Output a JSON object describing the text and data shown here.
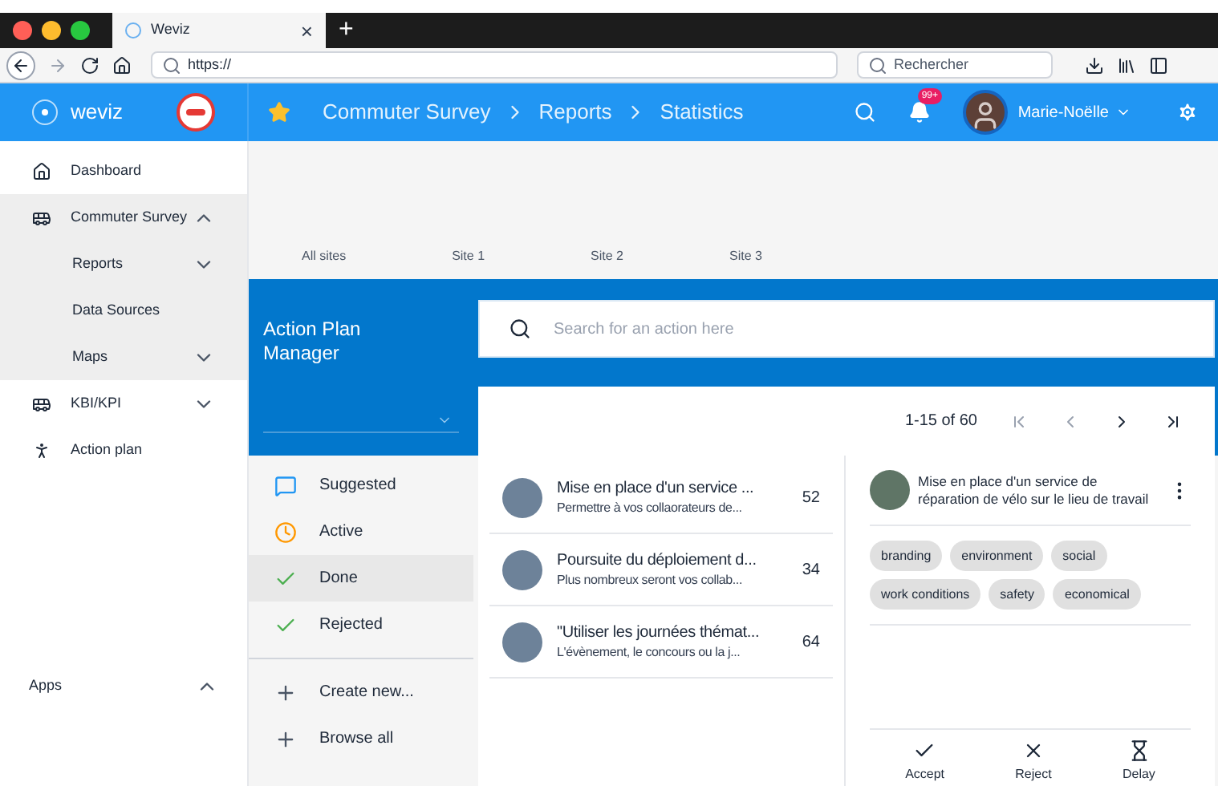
{
  "browser": {
    "tab_title": "Weviz",
    "tab_close": "×",
    "new_tab": "+",
    "url": "https://",
    "search_placeholder": "Rechercher"
  },
  "app_bar": {
    "brand": "weviz",
    "breadcrumbs": [
      "Commuter Survey",
      "Reports",
      "Statistics"
    ],
    "notification_count": "99+",
    "user": "Marie-Noëlle"
  },
  "sidebar": {
    "items": [
      {
        "label": "Dashboard",
        "kind": "home"
      },
      {
        "label": "Commuter Survey",
        "kind": "vehicle",
        "expanded": true,
        "children": [
          {
            "label": "Reports",
            "expanded": false
          },
          {
            "label": "Data Sources"
          },
          {
            "label": "Maps",
            "expanded": false
          }
        ]
      },
      {
        "label": "KBI/KPI",
        "kind": "vehicle",
        "expanded": false
      },
      {
        "label": "Action plan",
        "kind": "person"
      }
    ],
    "apps": {
      "label": "Apps",
      "expanded": true
    }
  },
  "site_tabs": [
    "All sites",
    "Site 1",
    "Site 2",
    "Site 3"
  ],
  "manager": {
    "title": "Action Plan Manager",
    "statuses": [
      {
        "label": "Suggested",
        "kind": "suggested",
        "selected": false
      },
      {
        "label": "Active",
        "kind": "active",
        "selected": false
      },
      {
        "label": "Done",
        "kind": "done",
        "selected": true
      },
      {
        "label": "Rejected",
        "kind": "rejected",
        "selected": false
      }
    ],
    "commands": [
      {
        "label": "Create new...",
        "kind": "plus"
      },
      {
        "label": "Browse all",
        "kind": "plus"
      }
    ]
  },
  "search": {
    "placeholder": "Search for an action here"
  },
  "pagination": {
    "range": "1-15 of 60"
  },
  "actions": [
    {
      "title": "Mise en place d'un service ...",
      "subtitle": "Permettre à vos collaorateurs de...",
      "count": "52"
    },
    {
      "title": "Poursuite du déploiement d...",
      "subtitle": "Plus nombreux seront vos collab...",
      "count": "34"
    },
    {
      "title": "\"Utiliser les journées thémat...",
      "subtitle": "L'évènement, le concours ou la j...",
      "count": "64"
    }
  ],
  "detail": {
    "title": "Mise en place d'un service de réparation de vélo sur le lieu de travail",
    "tags": [
      "branding",
      "environment",
      "social",
      "work conditions",
      "safety",
      "economical"
    ],
    "buttons": [
      {
        "label": "Accept",
        "kind": "accept"
      },
      {
        "label": "Reject",
        "kind": "reject"
      },
      {
        "label": "Delay",
        "kind": "delay"
      }
    ]
  }
}
